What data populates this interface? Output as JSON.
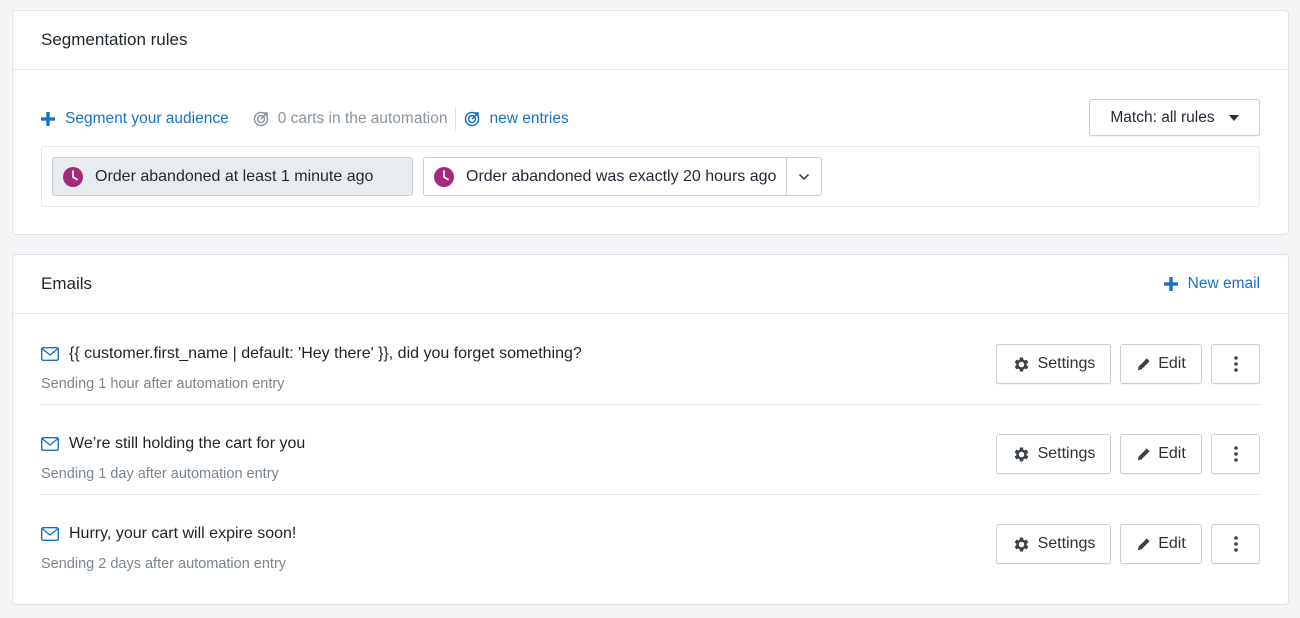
{
  "segmentation": {
    "title": "Segmentation rules",
    "segment_link": "Segment your audience",
    "carts_info": "0 carts in the automation",
    "new_entries": "new entries",
    "match_label": "Match: all rules",
    "rules": [
      {
        "label": "Order abandoned at least 1 minute ago"
      },
      {
        "label": "Order abandoned was exactly 20 hours ago"
      }
    ]
  },
  "emails": {
    "title": "Emails",
    "new_email": "New email",
    "items": [
      {
        "subject": "{{ customer.first_name | default: 'Hey there' }}, did you forget something?",
        "meta": "Sending 1 hour after automation entry"
      },
      {
        "subject": "We’re still holding the cart for you",
        "meta": "Sending 1 day after automation entry"
      },
      {
        "subject": "Hurry, your cart will expire soon!",
        "meta": "Sending 2 days after automation entry"
      }
    ],
    "settings_label": "Settings",
    "edit_label": "Edit"
  },
  "colors": {
    "accent": "#1672c8",
    "clock": "#a52a7a"
  }
}
